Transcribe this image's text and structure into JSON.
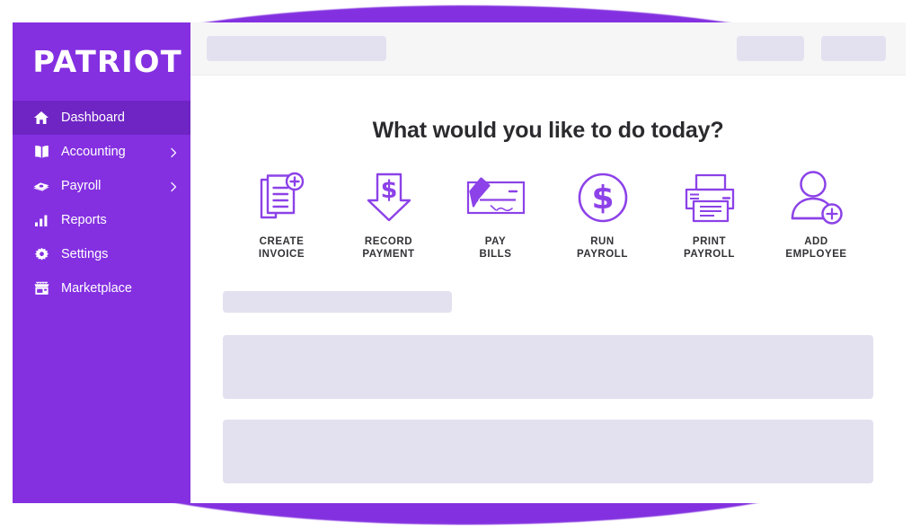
{
  "brand": {
    "name": "PATRIOT"
  },
  "colors": {
    "sidebar": "#8430e1",
    "sidebar_active": "#6f24c4",
    "accent": "#8331e0",
    "icon_stroke": "#8c42e8",
    "skeleton": "#e3e0ef",
    "topbar": "#f6f6f7",
    "title_text": "#2b2b2f"
  },
  "sidebar": {
    "items": [
      {
        "label": "Dashboard",
        "icon": "home-icon",
        "active": true,
        "expandable": false
      },
      {
        "label": "Accounting",
        "icon": "book-icon",
        "active": false,
        "expandable": true
      },
      {
        "label": "Payroll",
        "icon": "money-icon",
        "active": false,
        "expandable": true
      },
      {
        "label": "Reports",
        "icon": "bar-chart-icon",
        "active": false,
        "expandable": false
      },
      {
        "label": "Settings",
        "icon": "gear-icon",
        "active": false,
        "expandable": false
      },
      {
        "label": "Marketplace",
        "icon": "storefront-icon",
        "active": false,
        "expandable": false
      }
    ]
  },
  "topbar": {
    "search_placeholder": "",
    "placeholders": [
      {
        "name": "search-skeleton"
      },
      {
        "name": "action-skeleton-1"
      },
      {
        "name": "action-skeleton-2"
      }
    ]
  },
  "main": {
    "title": "What would you like to do today?",
    "actions": [
      {
        "label": "CREATE\nINVOICE",
        "icon": "invoice-add-icon"
      },
      {
        "label": "RECORD\nPAYMENT",
        "icon": "arrow-down-dollar-icon"
      },
      {
        "label": "PAY\nBILLS",
        "icon": "check-pen-icon"
      },
      {
        "label": "RUN\nPAYROLL",
        "icon": "dollar-circle-icon"
      },
      {
        "label": "PRINT\nPAYROLL",
        "icon": "printer-icon"
      },
      {
        "label": "ADD\nEMPLOYEE",
        "icon": "person-add-icon"
      }
    ],
    "content_placeholders": [
      {
        "name": "section-heading-skeleton"
      },
      {
        "name": "content-card-skeleton-1"
      },
      {
        "name": "content-card-skeleton-2"
      }
    ]
  }
}
